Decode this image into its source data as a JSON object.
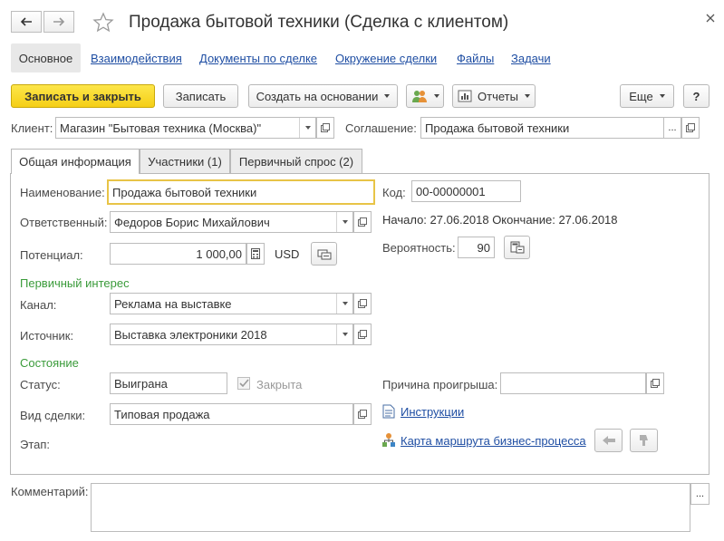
{
  "title": "Продажа бытовой техники (Сделка с клиентом)",
  "nav": {
    "tabs": [
      "Основное",
      "Взаимодействия",
      "Документы по сделке",
      "Окружение сделки",
      "Файлы",
      "Задачи"
    ]
  },
  "toolbar": {
    "save_close": "Записать и закрыть",
    "save": "Записать",
    "create_based": "Создать на основании",
    "reports": "Отчеты",
    "more": "Еще",
    "help": "?"
  },
  "client": {
    "label": "Клиент:",
    "value": "Магазин \"Бытовая техника (Москва)\""
  },
  "agreement": {
    "label": "Соглашение:",
    "value": "Продажа бытовой техники",
    "more": "..."
  },
  "tabs": [
    "Общая информация",
    "Участники (1)",
    "Первичный спрос (2)"
  ],
  "form": {
    "name_label": "Наименование:",
    "name_value": "Продажа бытовой техники",
    "code_label": "Код:",
    "code_value": "00-00000001",
    "responsible_label": "Ответственный:",
    "responsible_value": "Федоров Борис Михайлович",
    "dates": "Начало: 27.06.2018 Окончание: 27.06.2018",
    "potential_label": "Потенциал:",
    "potential_value": "1 000,00",
    "currency": "USD",
    "probability_label": "Вероятность:",
    "probability_value": "90",
    "primary_interest": "Первичный интерес",
    "channel_label": "Канал:",
    "channel_value": "Реклама на выставке",
    "source_label": "Источник:",
    "source_value": "Выставка электроники 2018",
    "state_section": "Состояние",
    "status_label": "Статус:",
    "status_value": "Выиграна",
    "closed_label": "Закрыта",
    "loss_reason_label": "Причина проигрыша:",
    "deal_type_label": "Вид сделки:",
    "deal_type_value": "Типовая продажа",
    "instructions": "Инструкции",
    "stage_label": "Этап:",
    "route_map": "Карта маршрута бизнес-процесса"
  },
  "comment": {
    "label": "Комментарий:",
    "more": "..."
  },
  "colors": {
    "primary": "#f5cf16",
    "link": "#1f4ea3",
    "section": "#3a9b3a",
    "focus": "#e8c447"
  }
}
